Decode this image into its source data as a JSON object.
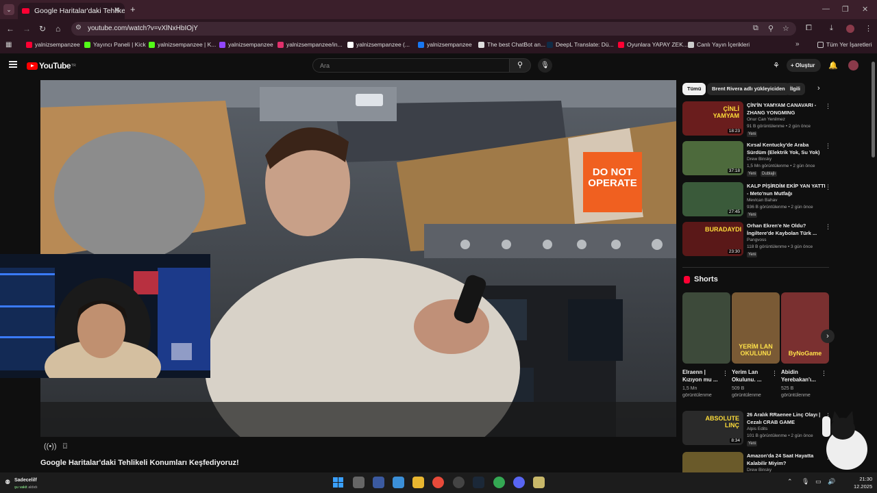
{
  "browser": {
    "tab_title": "Google Haritalar'daki Tehlikeli K",
    "url": "youtube.com/watch?v=vXlNxHbIOjY",
    "bookmarks": [
      {
        "label": "yalnizsempanzee",
        "icon": "youtube-icon",
        "color": "#ff0033"
      },
      {
        "label": "Yayıncı Paneli | Kick",
        "icon": "kick-icon",
        "color": "#53fc18"
      },
      {
        "label": "yalnizsempanzee | K...",
        "icon": "kick-icon",
        "color": "#53fc18"
      },
      {
        "label": "yalnizsempanzee",
        "icon": "twitch-icon",
        "color": "#9146ff"
      },
      {
        "label": "yalnizsempanzee/in...",
        "icon": "instagram-icon",
        "color": "#e1306c"
      },
      {
        "label": "yalnizsempanzee (...",
        "icon": "tiktok-icon",
        "color": "#ffffff"
      },
      {
        "label": "yalnizsempanzee",
        "icon": "facebook-icon",
        "color": "#1877f2"
      },
      {
        "label": "The best ChatBot an...",
        "icon": "chatbot-icon",
        "color": "#dddddd"
      },
      {
        "label": "DeepL Translate: Dü...",
        "icon": "deepl-icon",
        "color": "#0f2b46"
      },
      {
        "label": "Oyunlara YAPAY ZEK...",
        "icon": "youtube-icon",
        "color": "#ff0033"
      },
      {
        "label": "Canlı Yayın İçerikleri",
        "icon": "folder-icon",
        "color": "#cccccc"
      }
    ],
    "all_bookmarks": "Tüm Yer İşaretleri"
  },
  "youtube": {
    "logo_text": "YouTube",
    "logo_sup": "TR",
    "search_placeholder": "Ara",
    "create_label": "Oluştur",
    "video_title": "Google Haritalar'daki Tehlikeli Konumları Keşfediyoruz!",
    "sign_text": "DO NOT OPERATE"
  },
  "sidebar": {
    "chips": [
      "Tümü",
      "Brent Rivera adlı yükleyiciden",
      "İlgili"
    ],
    "recommendations": [
      {
        "title": "ÇİN'İN YAMYAM CANAVARI - ZHANG YONGMING",
        "channel": "Onur Can Yenilmez",
        "meta": "91 B görüntülenme • 2 gün önce",
        "badge": "Yeni",
        "duration": "18:23",
        "thumb_text": "ÇİNLİ YAMYAM",
        "color": "#6a1d1d"
      },
      {
        "title": "Kırsal Kentucky'de Araba Sürdüm (Elektrik Yok, Su Yok)",
        "channel": "Drew Binsky",
        "meta": "1,5 Mn görüntülenme • 2 gün önce",
        "badge": "Yeni",
        "badge2": "Dublajlı",
        "duration": "37:18",
        "thumb_text": "",
        "color": "#4d6a3c"
      },
      {
        "title": "KALP PİŞİRDİM EKİP YAN YATTI - Meto'nun Mutfağı",
        "channel": "Mevlcan Bahav",
        "meta": "936 B görüntülenme • 2 gün önce",
        "badge": "Yeni",
        "duration": "27:45",
        "thumb_text": "",
        "color": "#3a5a3a"
      },
      {
        "title": "Orhan Ekren'e Ne Oldu? İngiltere'de Kaybolan Türk ...",
        "channel": "Pangvoss",
        "meta": "118 B görüntülenme • 3 gün önce",
        "badge": "Yeni",
        "duration": "23:30",
        "thumb_text": "BURADAYDI",
        "color": "#5a1818"
      },
      {
        "title": "26 Aralık RRaenee Linç Olayı | Cezalı CRAB GAME",
        "channel": "Alpis Edits",
        "meta": "101 B görüntülenme • 2 gün önce",
        "badge": "Yeni",
        "duration": "8:34",
        "thumb_text": "ABSOLUTE LINÇ",
        "color": "#2a2a2a"
      },
      {
        "title": "Amazon'da 24 Saat Hayatta Kalabilir Miyim?",
        "channel": "Drew Binsky",
        "meta": "",
        "badge": "",
        "duration": "",
        "thumb_text": "",
        "color": "#6a5a2a"
      }
    ],
    "shorts_heading": "Shorts",
    "shorts": [
      {
        "title": "Elraenn | Kızıyon mu ...",
        "views": "1,5 Mn görüntülenme",
        "overlay": "",
        "color": "#3d4a3a"
      },
      {
        "title": "Yerim Lan Okulunu. ...",
        "views": "509 B görüntülenme",
        "overlay": "YERİM LAN OKULUNU",
        "color": "#7a5a35"
      },
      {
        "title": "Abidin Yerebakan'ı...",
        "views": "525 B görüntülenme",
        "overlay": "ByNoGame",
        "color": "#7a3030"
      }
    ]
  },
  "taskbar": {
    "user_name": "Sadecelilf",
    "user_status": "şu vakit",
    "user_sub": "aldıdı",
    "time": "21:30",
    "date": "12.2025"
  }
}
